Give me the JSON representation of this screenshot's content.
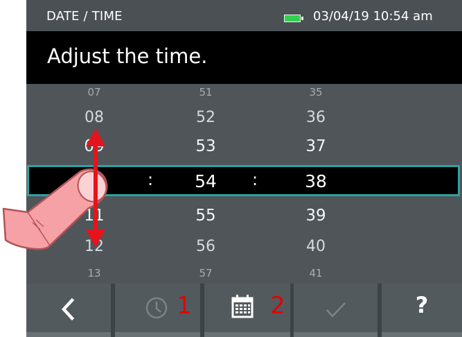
{
  "status_bar": {
    "title": "DATE / TIME",
    "datetime": "03/04/19 10:54 am",
    "battery_color": "#2fd14a"
  },
  "prompt": "Adjust the time.",
  "time_picker": {
    "hours": {
      "above3": "07",
      "above2": "08",
      "above1": "09",
      "selected": "",
      "below1": "11",
      "below2": "12",
      "below3": "13"
    },
    "minutes": {
      "above3": "51",
      "above2": "52",
      "above1": "53",
      "selected": "54",
      "below1": "55",
      "below2": "56",
      "below3": "57"
    },
    "seconds": {
      "above3": "35",
      "above2": "36",
      "above1": "37",
      "selected": "38",
      "below1": "39",
      "below2": "40",
      "below3": "41"
    },
    "separator": ":",
    "selection_color": "#2aa4a2"
  },
  "toolbar": {
    "back_icon": "chevron-left-icon",
    "clock_icon": "clock-icon",
    "clock_label": "1",
    "calendar_icon": "calendar-icon",
    "calendar_label": "2",
    "confirm_icon": "checkmark-icon",
    "help_label": "?"
  },
  "annotation": {
    "gesture": "finger swipe up/down",
    "arrow_color": "#e5141c",
    "label_color": "#e30000"
  }
}
